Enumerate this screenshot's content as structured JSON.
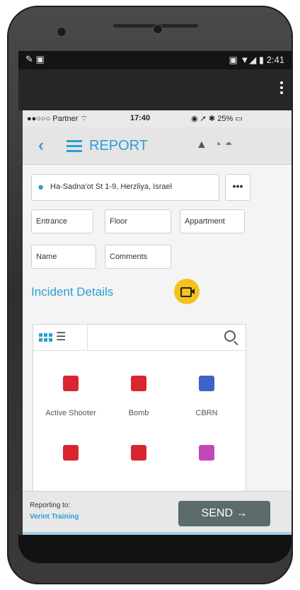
{
  "android_status": {
    "time": "2:41"
  },
  "ios_status": {
    "carrier": "Partner",
    "time": "17:40",
    "battery": "25%"
  },
  "header": {
    "title": "REPORT"
  },
  "address": {
    "value": "Ha-Sadna'ot St 1-9, Herzliya, Israel",
    "more_label": "•••"
  },
  "fields": {
    "entrance": "Entrance",
    "floor": "Floor",
    "appartment": "Appartment",
    "name": "Name",
    "comments": "Comments"
  },
  "incident": {
    "title": "Incident Details"
  },
  "categories": [
    {
      "label": "Active Shooter",
      "color": "#d9252f",
      "icon": "active-shooter-icon"
    },
    {
      "label": "Bomb",
      "color": "#d9252f",
      "icon": "bomb-icon"
    },
    {
      "label": "CBRN",
      "color": "#3f62c8",
      "icon": "cbrn-icon"
    },
    {
      "label": "",
      "color": "#d9252f",
      "icon": "category-icon"
    },
    {
      "label": "",
      "color": "#d9252f",
      "icon": "category-icon"
    },
    {
      "label": "",
      "color": "#c048b8",
      "icon": "category-icon"
    }
  ],
  "footer": {
    "reporting_to_label": "Reporting to:",
    "reporting_to_value": "Verint Training",
    "send_label": "SEND →"
  }
}
